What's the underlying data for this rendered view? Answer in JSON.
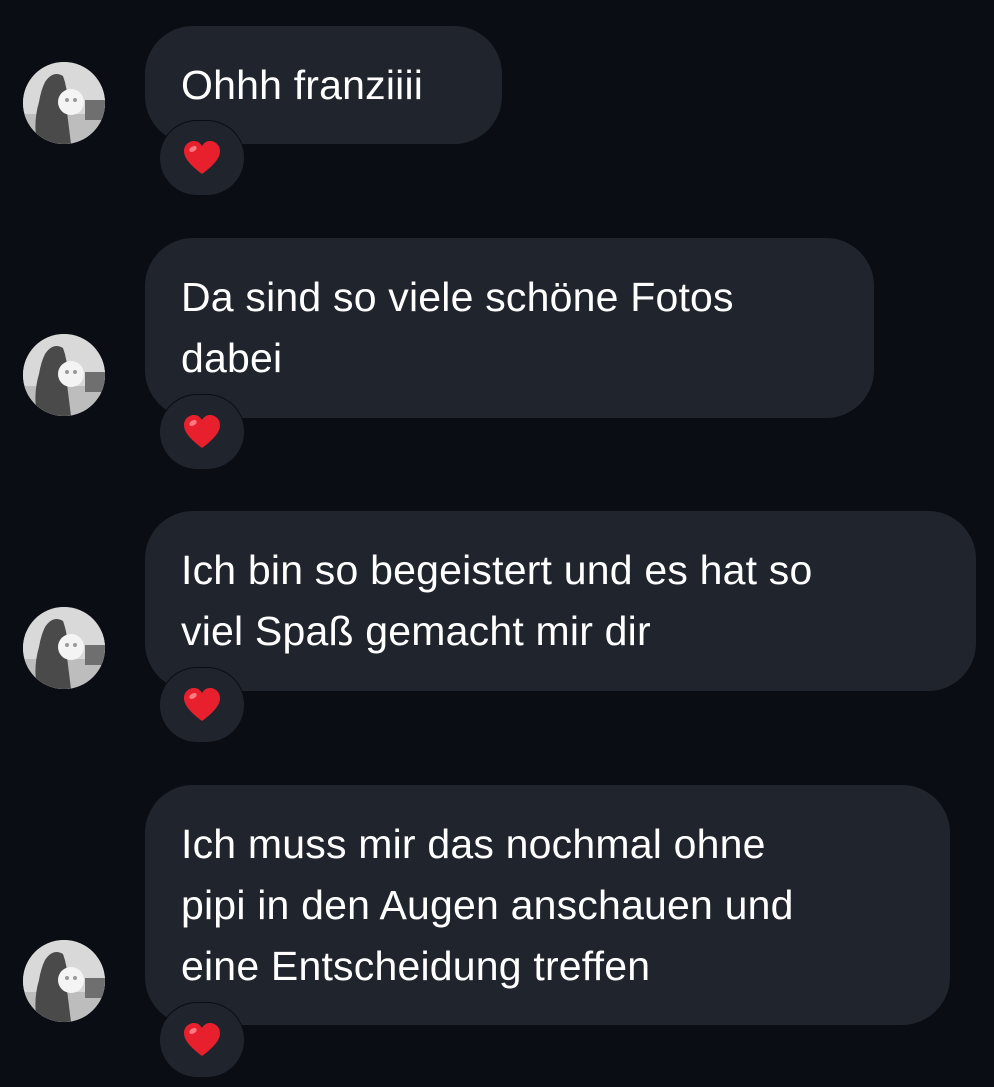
{
  "colors": {
    "background": "#0a0e14",
    "bubble": "#20252d",
    "text": "#ffffff",
    "heart": "#e8202e"
  },
  "messages": [
    {
      "lines": [
        "Ohhh franziiii"
      ],
      "reaction": "heart-icon"
    },
    {
      "lines": [
        "Da sind so viele schöne Fotos",
        "dabei"
      ],
      "reaction": "heart-icon"
    },
    {
      "lines": [
        "Ich bin so begeistert und es hat so",
        "viel Spaß gemacht mir dir"
      ],
      "reaction": "heart-icon"
    },
    {
      "lines": [
        "Ich muss mir das nochmal ohne",
        "pipi in den Augen anschauen und",
        "eine Entscheidung treffen"
      ],
      "reaction": "heart-icon"
    }
  ]
}
